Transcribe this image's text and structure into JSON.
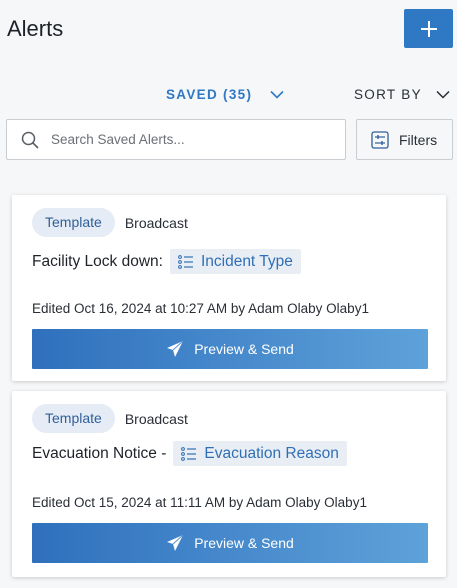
{
  "header": {
    "title": "Alerts",
    "add_label": "+"
  },
  "filters_bar": {
    "saved_label": "SAVED (35)",
    "sort_label": "SORT BY"
  },
  "search": {
    "placeholder": "Search Saved Alerts...",
    "value": "",
    "filters_label": "Filters"
  },
  "alerts": [
    {
      "tag": "Template",
      "type": "Broadcast",
      "title": "Facility Lock down:",
      "field": "Incident Type",
      "edited": "Edited Oct 16, 2024 at 10:27 AM by Adam Olaby Olaby1",
      "action": "Preview & Send"
    },
    {
      "tag": "Template",
      "type": "Broadcast",
      "title": "Evacuation Notice -",
      "field": "Evacuation Reason",
      "edited": "Edited Oct 15, 2024 at 11:11 AM by Adam Olaby Olaby1",
      "action": "Preview & Send"
    }
  ],
  "colors": {
    "accent": "#2f78c4",
    "background": "#f6f7f9",
    "chip_bg": "#e9eef5"
  },
  "icons": {
    "add": "plus-icon",
    "saved_dropdown": "chevron-down-icon",
    "sort_dropdown": "chevron-down-icon",
    "search": "search-icon",
    "filters": "filter-sliders-icon",
    "field": "list-icon",
    "send": "paper-plane-icon"
  }
}
